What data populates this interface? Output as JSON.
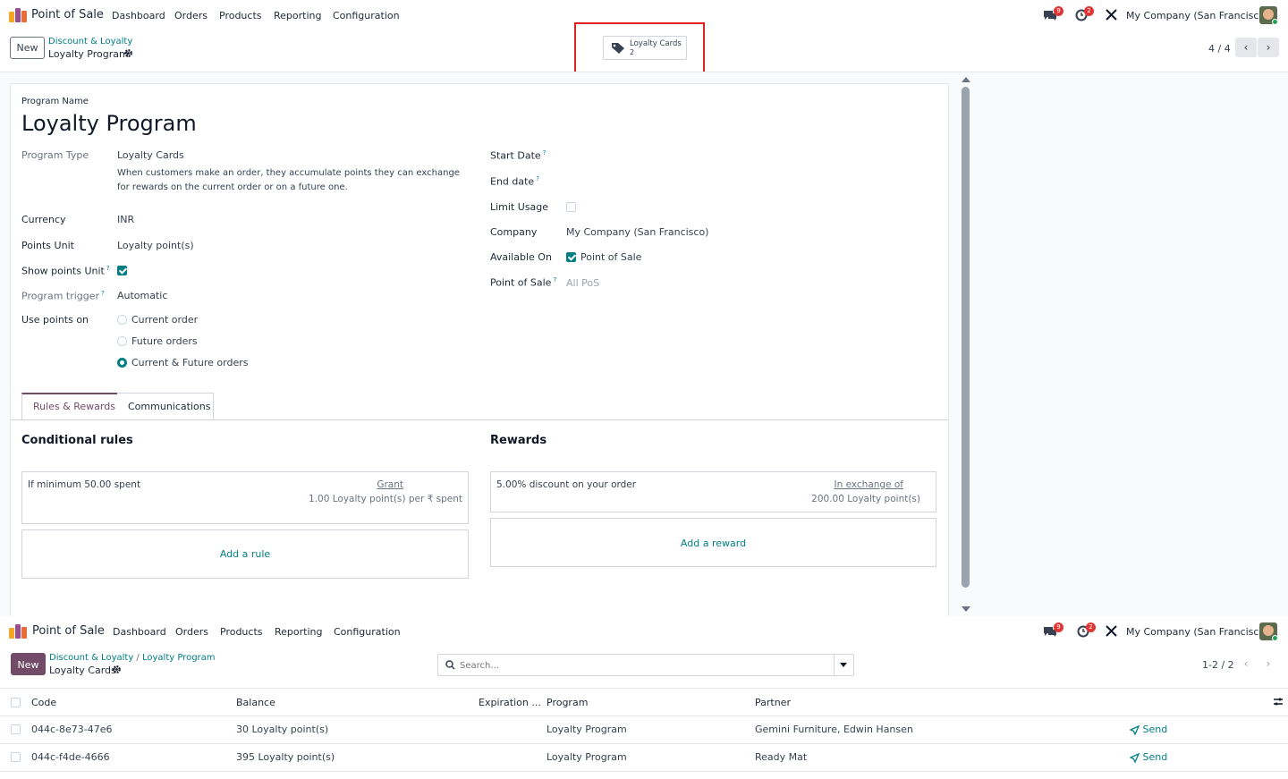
{
  "top_nav": {
    "app_title": "Point of Sale",
    "menu": [
      "Dashboard",
      "Orders",
      "Products",
      "Reporting",
      "Configuration"
    ],
    "messages_badge": "9",
    "activities_badge": "2",
    "company": "My Company (San Francisco)"
  },
  "form_control": {
    "new_label": "New",
    "breadcrumb_parent": "Discount & Loyalty",
    "breadcrumb_current": "Loyalty Program",
    "smart_button_label": "Loyalty Cards",
    "smart_button_count": "2",
    "pager": "4 / 4"
  },
  "form": {
    "program_name_label": "Program Name",
    "program_name": "Loyalty Program",
    "program_type_label": "Program Type",
    "program_type": "Loyalty Cards",
    "program_type_help": "When customers make an order, they accumulate points they can exchange for rewards on the current order or on a future one.",
    "currency_label": "Currency",
    "currency": "INR",
    "points_unit_label": "Points Unit",
    "points_unit": "Loyalty point(s)",
    "show_points_unit_label": "Show points Unit",
    "program_trigger_label": "Program trigger",
    "program_trigger": "Automatic",
    "use_points_on_label": "Use points on",
    "use_points_options": [
      "Current order",
      "Future orders",
      "Current & Future orders"
    ],
    "start_date_label": "Start Date",
    "end_date_label": "End date",
    "limit_usage_label": "Limit Usage",
    "company_label": "Company",
    "company": "My Company (San Francisco)",
    "available_on_label": "Available On",
    "available_on": "Point of Sale",
    "pos_label": "Point of Sale",
    "pos_placeholder": "All PoS"
  },
  "tabs": [
    "Rules & Rewards",
    "Communications"
  ],
  "rules": {
    "title": "Conditional rules",
    "rule_condition": "If minimum 50.00 spent",
    "rule_grant_link": "Grant",
    "rule_grant": "1.00 Loyalty point(s) per ₹ spent",
    "add_rule": "Add a rule"
  },
  "rewards": {
    "title": "Rewards",
    "reward_desc": "5.00% discount on your order",
    "reward_link": "In exchange of",
    "reward_cost": "200.00 Loyalty point(s)",
    "add_reward": "Add a reward"
  },
  "list_nav": {
    "breadcrumb_parent": "Discount & Loyalty",
    "breadcrumb_mid": "Loyalty Program",
    "breadcrumb_current": "Loyalty Cards",
    "search_placeholder": "Search...",
    "pager": "1-2 / 2"
  },
  "list": {
    "columns": [
      "Code",
      "Balance",
      "Expiration ...",
      "Program",
      "Partner"
    ],
    "rows": [
      {
        "code": "044c-8e73-47e6",
        "balance": "30 Loyalty point(s)",
        "expiration": "",
        "program": "Loyalty Program",
        "partner": "Gemini Furniture, Edwin Hansen",
        "action": "Send"
      },
      {
        "code": "044c-f4de-4666",
        "balance": "395 Loyalty point(s)",
        "expiration": "",
        "program": "Loyalty Program",
        "partner": "Ready Mat",
        "action": "Send"
      }
    ]
  },
  "colors": {
    "accent": "#017e84",
    "brand": "#714b67",
    "highlight": "#e02020"
  }
}
